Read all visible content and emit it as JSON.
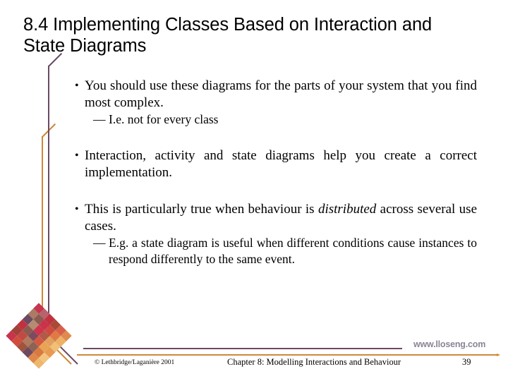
{
  "slide": {
    "title": "8.4 Implementing Classes Based on Interaction and State Diagrams",
    "bullet_marker": "•",
    "dash_marker": "—"
  },
  "content": {
    "bullets": [
      {
        "text": "You should use these diagrams for the parts of your system that you find most complex.",
        "sub": "I.e. not for every class"
      },
      {
        "text": "Interaction, activity and state diagrams help you create a correct implementation.",
        "sub": null
      },
      {
        "text_before": "This is particularly true when behaviour is ",
        "text_italic": "distributed",
        "text_after": " across several use cases.",
        "sub": "E.g. a state diagram is useful when different conditions cause instances to respond differently to the same event."
      }
    ]
  },
  "watermark": {
    "url": "www.lloseng.com"
  },
  "footer": {
    "copyright": "© Lethbridge/Laganière 2001",
    "chapter": "Chapter 8: Modelling Interactions and Behaviour",
    "page_number": "39"
  },
  "colors": {
    "rule_purple": "#6b4a63",
    "rule_orange": "#cf8736",
    "watermark_gray": "#8b8596",
    "text_black": "#000000",
    "background": "#ffffff"
  },
  "quilt": {
    "cells": [
      "#c7354f",
      "#b8626b",
      "#c2313f",
      "#a84a38",
      "#d8604a",
      "#e08a4e",
      "#a97c63",
      "#8d5a52",
      "#c9334b",
      "#cf4a3e",
      "#e07a45",
      "#edb167",
      "#6b4a63",
      "#b38c72",
      "#d1334c",
      "#b05a4a",
      "#e3a05c",
      "#f0c079",
      "#c2313f",
      "#8a5b4e",
      "#7d4a5e",
      "#d4583f",
      "#e8a455",
      "#e89a52",
      "#a14138",
      "#c14a42",
      "#b07a5c",
      "#8e6355",
      "#d9793f",
      "#f2c47f",
      "#c9334b",
      "#d04d3d",
      "#a0533f",
      "#6e4a60",
      "#e08648",
      "#edb86d"
    ]
  }
}
